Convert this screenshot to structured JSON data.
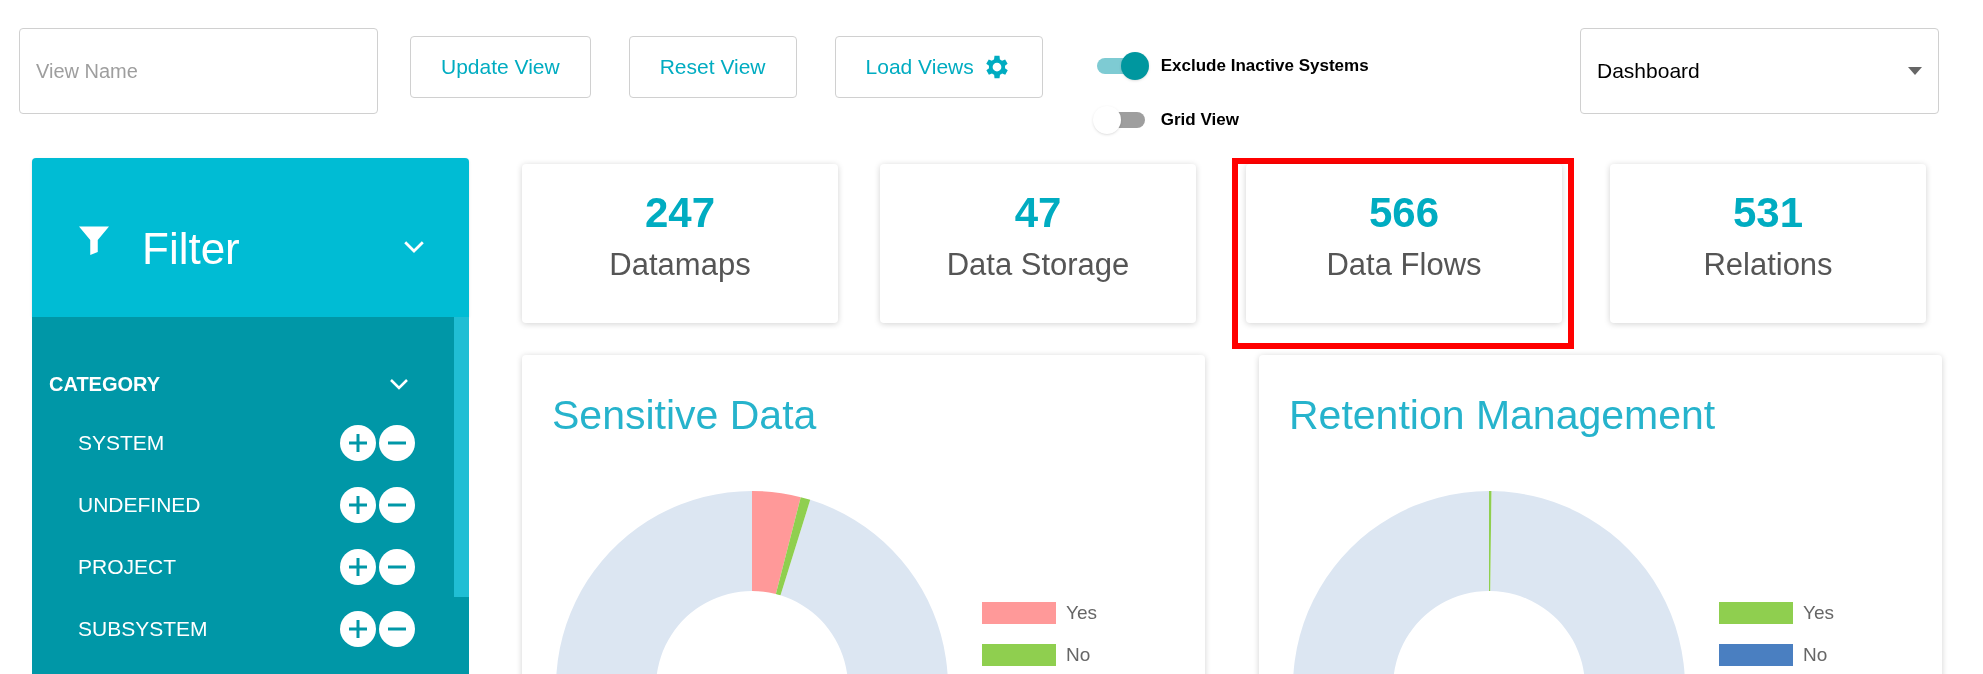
{
  "toolbar": {
    "view_name": {
      "placeholder": "View Name"
    },
    "buttons": [
      {
        "label": "Update View",
        "kind": "text"
      },
      {
        "label": "Reset View",
        "kind": "text"
      },
      {
        "label": "Load Views",
        "kind": "gear"
      }
    ],
    "toggles": [
      {
        "label": "Exclude Inactive Systems",
        "on": true
      },
      {
        "label": "Grid View",
        "on": false
      }
    ],
    "view_select": {
      "value": "Dashboard"
    }
  },
  "filter": {
    "title": "Filter",
    "expanded": true,
    "category": {
      "label": "CATEGORY",
      "expanded": true,
      "items": [
        {
          "label": "SYSTEM"
        },
        {
          "label": "UNDEFINED"
        },
        {
          "label": "PROJECT"
        },
        {
          "label": "SUBSYSTEM"
        }
      ]
    }
  },
  "stats": [
    {
      "value": "247",
      "label": "Datamaps",
      "highlighted": false
    },
    {
      "value": "47",
      "label": "Data Storage",
      "highlighted": false
    },
    {
      "value": "566",
      "label": "Data Flows",
      "highlighted": true
    },
    {
      "value": "531",
      "label": "Relations",
      "highlighted": false
    }
  ],
  "charts": [
    {
      "title": "Sensitive Data",
      "legend": [
        {
          "label": "Yes",
          "color": "#ff9999"
        },
        {
          "label": "No",
          "color": "#8fcf4f"
        }
      ]
    },
    {
      "title": "Retention Management",
      "legend": [
        {
          "label": "Yes",
          "color": "#8fcf4f"
        },
        {
          "label": "No",
          "color": "#4a7fc1"
        }
      ]
    }
  ]
}
